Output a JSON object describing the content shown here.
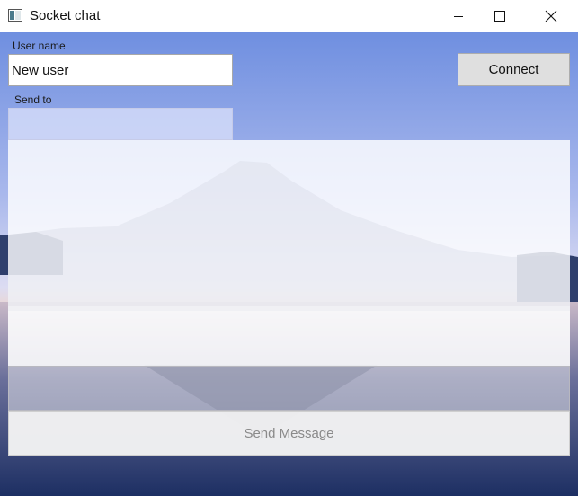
{
  "window": {
    "title": "Socket chat",
    "icon": "window-app-icon",
    "controls": [
      "minimize-icon",
      "maximize-icon",
      "close-icon"
    ]
  },
  "form": {
    "user_name_label": "User name",
    "user_name_value": "New user",
    "connect_label": "Connect",
    "send_to_label": "Send to",
    "send_to_value": "",
    "chat_log": "",
    "message_value": "",
    "send_message_label": "Send Message"
  },
  "colors": {
    "sky_top": "#6f8fe0",
    "sky_horizon": "#f3d3c0",
    "water": "#1d2f63",
    "button_face": "#dfdfdf",
    "disabled_text": "#8a8a8a"
  }
}
